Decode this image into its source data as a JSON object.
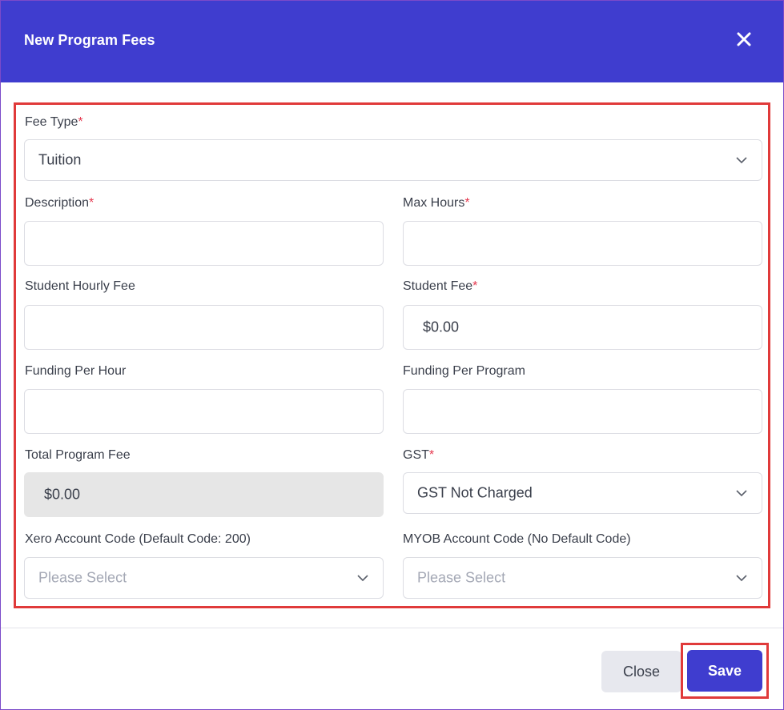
{
  "dialog": {
    "title": "New Program Fees",
    "close_icon": "close-icon"
  },
  "form": {
    "fee_type": {
      "label": "Fee Type",
      "required_mark": "*",
      "value": "Tuition"
    },
    "description": {
      "label": "Description",
      "required_mark": "*",
      "value": ""
    },
    "max_hours": {
      "label": "Max Hours",
      "required_mark": "*",
      "value": ""
    },
    "student_hourly_fee": {
      "label": "Student Hourly Fee",
      "value": ""
    },
    "student_fee": {
      "label": "Student Fee",
      "required_mark": "*",
      "value": "$0.00"
    },
    "funding_per_hour": {
      "label": "Funding Per Hour",
      "value": ""
    },
    "funding_per_program": {
      "label": "Funding Per Program",
      "value": ""
    },
    "total_program_fee": {
      "label": "Total Program Fee",
      "value": "$0.00"
    },
    "gst": {
      "label": "GST",
      "required_mark": "*",
      "value": "GST Not Charged"
    },
    "xero_account_code": {
      "label": "Xero Account Code (Default Code: 200)",
      "placeholder": "Please Select"
    },
    "myob_account_code": {
      "label": "MYOB Account Code (No Default Code)",
      "placeholder": "Please Select"
    }
  },
  "footer": {
    "close_label": "Close",
    "save_label": "Save"
  },
  "colors": {
    "header": "#3f3dcf",
    "primary_button": "#3f3dcf",
    "highlight_outline": "#e03a3a",
    "required_mark": "#e5384e"
  }
}
